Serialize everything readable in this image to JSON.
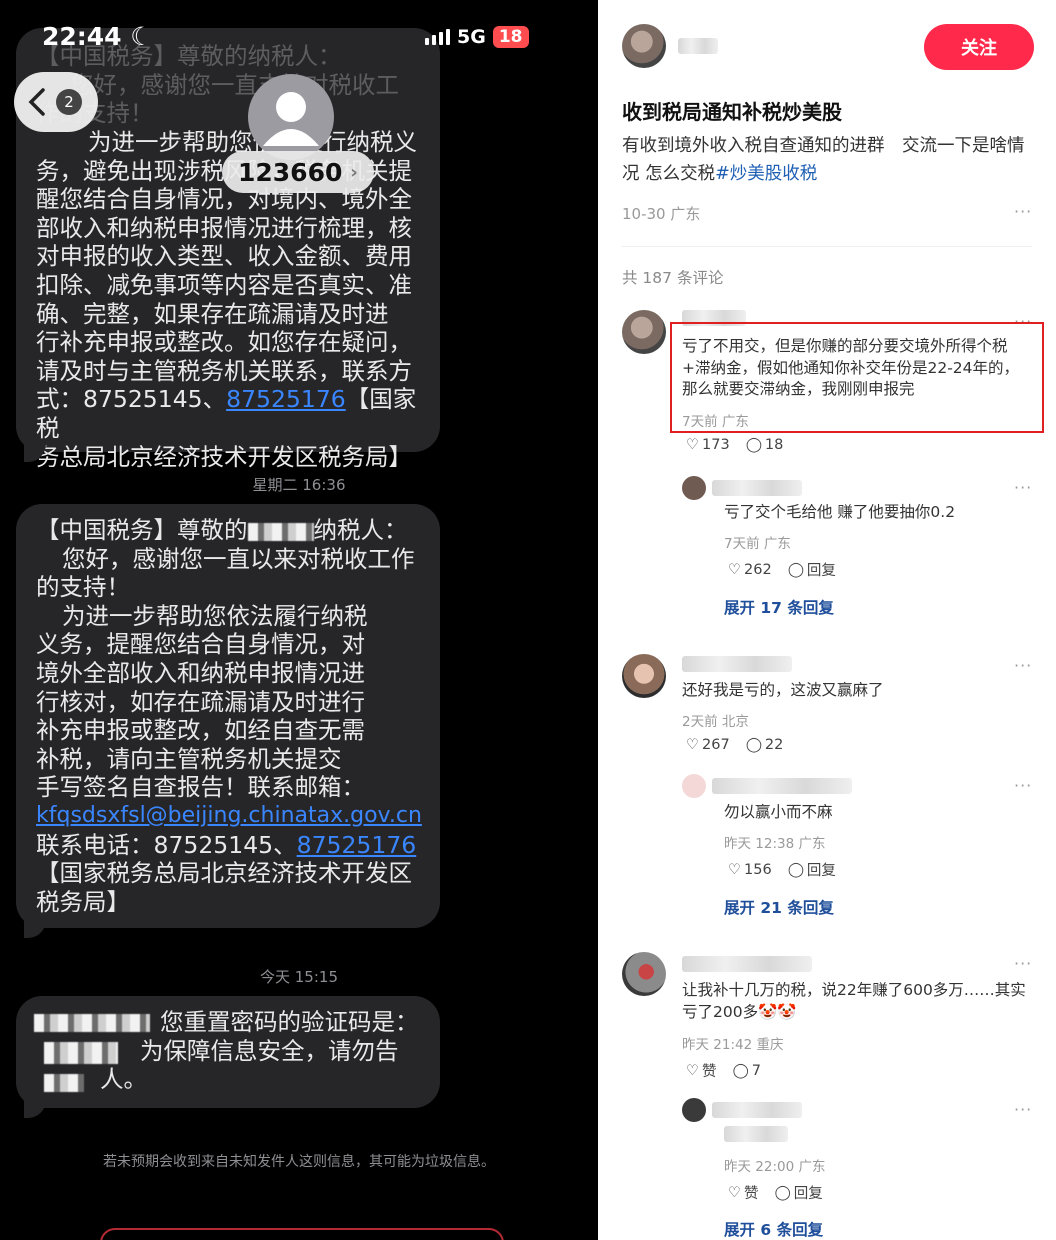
{
  "status_bar": {
    "time": "22:44",
    "network": "5G",
    "battery": "18"
  },
  "header": {
    "unread_count": "2",
    "contact_number": "123660"
  },
  "messages": {
    "faded_lines": [
      "【中国税务】尊敬的纳税人：",
      "您好，感谢您一直支持对税收工",
      "作的支持！"
    ],
    "msg1_lines": [
      "为进一步帮助您依法履行纳税义",
      "务，避免出现涉税风险，税务机关提",
      "醒您结合自身情况，对境内、境外全",
      "部收入和纳税申报情况进行梳理，核",
      "对申报的收入类型、收入金额、费用",
      "扣除、减免事项等内容是否真实、准",
      "确、完整，如果存在疏漏请及时进",
      "行补充申报或整改。如您存在疑问，",
      "请及时与主管税务机关联系，联系方"
    ],
    "msg1_phone_prefix": "式：87525145、",
    "msg1_phone_link": "87525176",
    "msg1_phone_suffix": "【国家税",
    "msg1_last_line": "务总局北京经济技术开发区税务局】",
    "timestamp1": "星期二 16:36",
    "msg2_line1_a": "【中国税务】尊敬的",
    "msg2_line1_b": "纳税人：",
    "msg2_lines": [
      "您好，感谢您一直以来对税收工作",
      "的支持！",
      "为进一步帮助您依法履行纳税",
      "义务，提醒您结合自身情况，对",
      "境外全部收入和纳税申报情况进",
      "行核对，如存在疏漏请及时进行",
      "补充申报或整改，如经自查无需",
      "补税，请向主管税务机关提交",
      "手写签名自查报告！联系邮箱："
    ],
    "msg2_email": "kfqsdsxfsl@beijing.chinatax.gov.cn",
    "msg2_phone_prefix": "联系电话：87525145、",
    "msg2_phone_link": "87525176",
    "msg2_last_lines": [
      "【国家税务总局北京经济技术开发区",
      "税务局】"
    ],
    "timestamp2": "今天 15:15",
    "msg3_line1": "您重置密码的验证码是：",
    "msg3_line2": "为保障信息安全，请勿告",
    "msg3_line3": "人。",
    "junk_note": "若未预期会收到来自未知发件人这则信息，其可能为垃圾信息。"
  },
  "post": {
    "follow_label": "关注",
    "title": "收到税局通知补税炒美股",
    "body": "有收到境外收入税自查通知的进群　交流一下是啥情况 怎么交税",
    "hashtag": "#炒美股收税",
    "meta": "10-30 广东",
    "more": "···",
    "comment_count": "共 187 条评论"
  },
  "comments": [
    {
      "text": "亏了不用交，但是你赚的部分要交境外所得个税+滞纳金，假如他通知你补交年份是22-24年的，那么就要交滞纳金，我刚刚申报完",
      "meta": "7天前 广东",
      "likes": "173",
      "replies": "18",
      "reply": {
        "text": "亏了交个毛给他 赚了他要抽你0.2",
        "meta": "7天前 广东",
        "likes": "262",
        "reply_label": "回复"
      },
      "expand": "展开 17 条回复"
    },
    {
      "text": "还好我是亏的，这波又赢麻了",
      "meta": "2天前 北京",
      "likes": "267",
      "replies": "22",
      "reply": {
        "text": "勿以赢小而不麻",
        "meta": "昨天 12:38 广东",
        "likes": "156",
        "reply_label": "回复"
      },
      "expand": "展开 21 条回复"
    },
    {
      "text": "让我补十几万的税，说22年赚了600多万……其实亏了200多🤡🤡",
      "meta": "昨天 21:42 重庆",
      "likes": "赞",
      "replies": "7",
      "reply": {
        "text": "",
        "meta": "昨天 22:00 广东",
        "likes": "赞",
        "reply_label": "回复"
      },
      "expand": "展开 6 条回复"
    }
  ],
  "colors": {
    "follow_button": "#ff2a4b",
    "link": "#3a86ff",
    "expand": "#1f4e9a",
    "highlight_box": "#e02020",
    "sms_bubble": "#262628"
  }
}
